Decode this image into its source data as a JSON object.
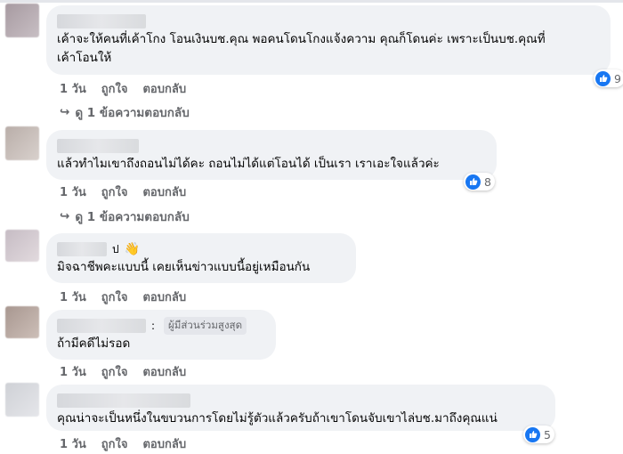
{
  "comments": [
    {
      "text": "เค้าจะให้คนที่เค้าโกง โอนเงินบช.คุณ พอคนโดนโกงแจ้งความ คุณก็โดนค่ะ เพราะเป็นบช.คุณที่\nเค้าโอนให้",
      "time": "1 วัน",
      "like_label": "ถูกใจ",
      "reply_label": "ตอบกลับ",
      "reaction_count": "9",
      "replies_label": "ดู 1 ข้อความตอบกลับ"
    },
    {
      "text": "แล้วทำไมเขาถึงถอนไม่ได้คะ ถอนไม่ได้แต่โอนได้ เป็นเรา เราเอะใจแล้วค่ะ",
      "time": "1 วัน",
      "like_label": "ถูกใจ",
      "reply_label": "ตอบกลับ",
      "reaction_count": "8",
      "replies_label": "ดู 1 ข้อความตอบกลับ"
    },
    {
      "name_suffix": "ป",
      "text": "มิจฉาชีพคะแบบนี้ เคยเห็นข่าวแบบนี้อยู่เหมือนกัน",
      "time": "1 วัน",
      "like_label": "ถูกใจ",
      "reply_label": "ตอบกลับ"
    },
    {
      "name_suffix": ":",
      "badge": "ผู้มีส่วนร่วมสูงสุด",
      "text": "ถ้ามีคดีไม่รอด",
      "time": "1 วัน",
      "like_label": "ถูกใจ",
      "reply_label": "ตอบกลับ"
    },
    {
      "text": "คุณน่าจะเป็นหนึ่งในขบวนการโดยไม่รู้ตัวแล้วครับถ้าเขาโดนจับเขาไล่บช.มาถึงคุณแน่",
      "time": "1 วัน",
      "like_label": "ถูกใจ",
      "reply_label": "ตอบกลับ",
      "reaction_count": "5"
    }
  ],
  "colors": {
    "bubble": "#f0f2f5",
    "like_blue": "#1877f2",
    "meta_text": "#65676b"
  },
  "icons": {
    "like": "thumbs-up-icon",
    "reply_arrow": "reply-arrow-icon",
    "wave": "waving-hand-icon"
  }
}
